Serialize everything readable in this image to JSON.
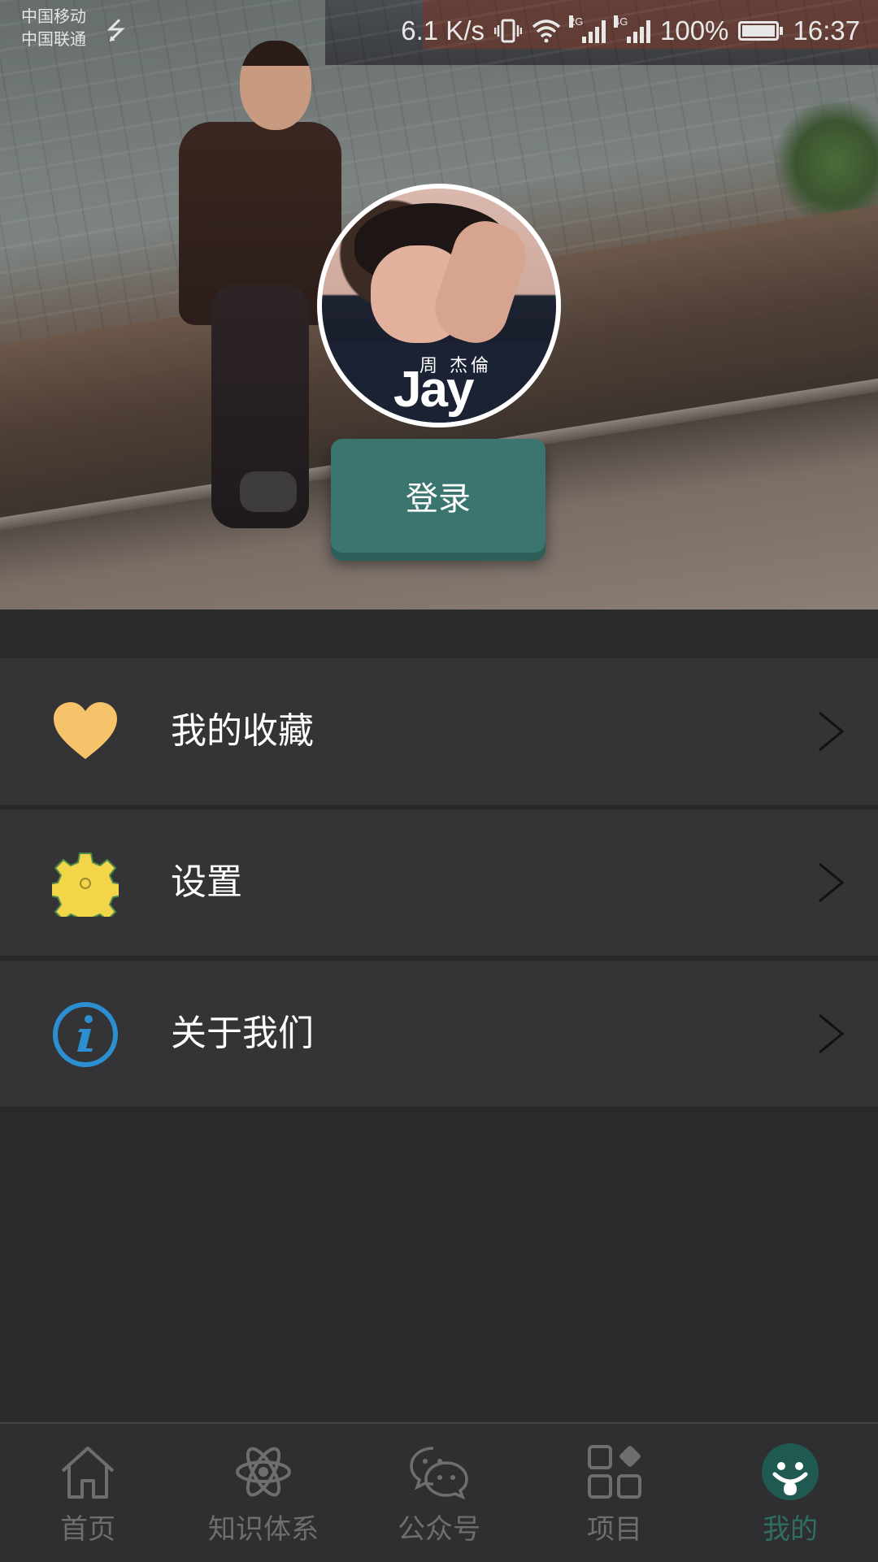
{
  "status_bar": {
    "carrier_1": "中国移动",
    "carrier_2": "中国联通",
    "net_speed": "6.1 K/s",
    "signal_1_tag": "2G",
    "signal_2_tag": "4G",
    "battery": "100%",
    "battery_level": 1.0,
    "time": "16:37"
  },
  "profile": {
    "avatar_text_cn": "周 杰倫",
    "avatar_text_en": "Jay",
    "login_label": "登录",
    "accent_color": "#3b7570"
  },
  "menu": {
    "items": [
      {
        "label": "我的收藏",
        "icon": "heart-icon",
        "color": "#f7c36a"
      },
      {
        "label": "设置",
        "icon": "gear-icon",
        "color": "#f2d548"
      },
      {
        "label": "关于我们",
        "icon": "info-icon",
        "color": "#2b8fd1"
      }
    ]
  },
  "bottom_nav": {
    "items": [
      {
        "label": "首页",
        "icon": "home-icon"
      },
      {
        "label": "知识体系",
        "icon": "atom-icon"
      },
      {
        "label": "公众号",
        "icon": "wechat-icon"
      },
      {
        "label": "项目",
        "icon": "grid-icon"
      },
      {
        "label": "我的",
        "icon": "smiley-icon"
      }
    ],
    "active_index": 4,
    "active_color": "#2f6e64",
    "inactive_color": "#6e6e70"
  }
}
